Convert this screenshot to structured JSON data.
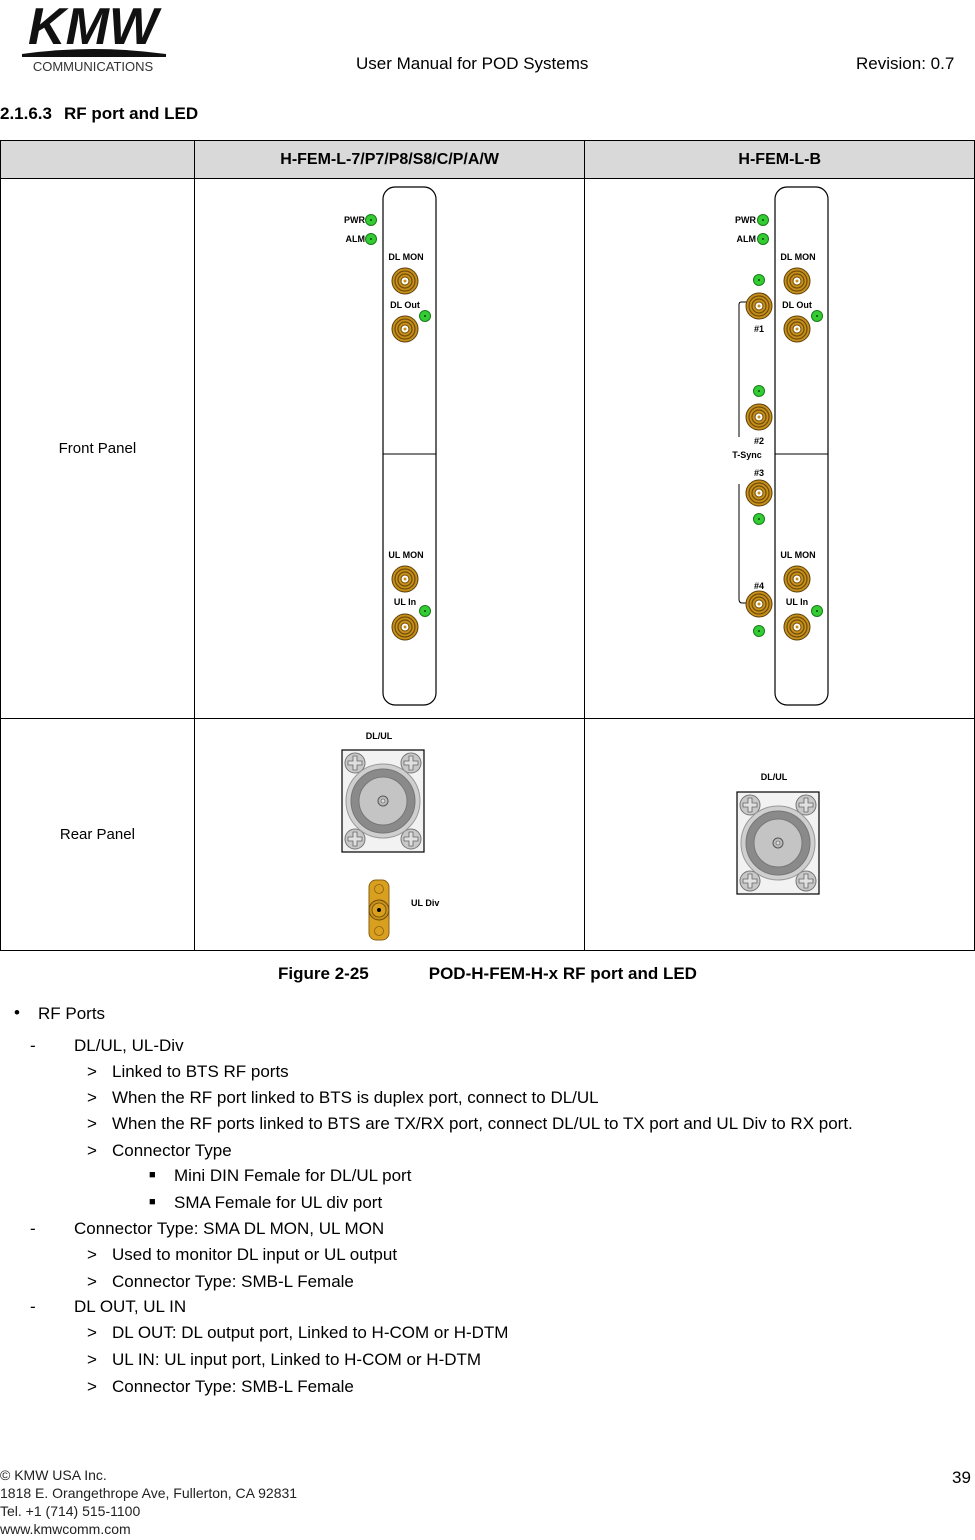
{
  "header": {
    "logo": {
      "name": "KMW",
      "subtitle": "COMMUNICATIONS"
    },
    "title": "User Manual for POD Systems",
    "revision": "Revision: 0.7"
  },
  "section": {
    "number": "2.1.6.3",
    "title": "RF port and LED"
  },
  "table": {
    "columns": [
      "",
      "H-FEM-L-7/P7/P8/S8/C/P/A/W",
      "H-FEM-L-B"
    ],
    "rows": [
      {
        "label": "Front Panel"
      },
      {
        "label": "Rear Panel"
      }
    ],
    "front_panel": {
      "led_pwr": "PWR",
      "led_alm": "ALM",
      "dl_mon": "DL MON",
      "dl_out": "DL Out",
      "ul_mon": "UL MON",
      "ul_in": "UL In",
      "tsync": "T-Sync",
      "tsync_ports": [
        "#1",
        "#2",
        "#3",
        "#4"
      ],
      "led_color": "#33cc33",
      "connector_color": "#c8901a"
    },
    "rear_panel": {
      "dl_ul": "DL/UL",
      "ul_div": "UL Div"
    }
  },
  "caption": {
    "figure": "Figure 2-25",
    "text": "POD-H-FEM-H-x RF port and LED"
  },
  "body": {
    "bullet": "RF Ports",
    "items": [
      {
        "level": 1,
        "marker": "-",
        "text": "DL/UL, UL-Div"
      },
      {
        "level": 2,
        "marker": ">",
        "text": "Linked  to BTS RF ports"
      },
      {
        "level": 2,
        "marker": ">",
        "text": "When the RF port linked to BTS is duplex port, connect to DL/UL"
      },
      {
        "level": 2,
        "marker": ">",
        "text": "When the RF ports linked to BTS are TX/RX port, connect DL/UL to TX port and UL Div to RX port."
      },
      {
        "level": 2,
        "marker": ">",
        "text": "Connector Type"
      },
      {
        "level": 3,
        "marker": "■",
        "text": "Mini DIN Female for DL/UL port"
      },
      {
        "level": 3,
        "marker": "■",
        "text": "SMA Female for UL div port"
      },
      {
        "level": 1,
        "marker": "-",
        "text": "Connector Type: SMA DL MON, UL MON"
      },
      {
        "level": 2,
        "marker": ">",
        "text": "Used to monitor DL input or UL output"
      },
      {
        "level": 2,
        "marker": ">",
        "text": "Connector Type: SMB-L Female"
      },
      {
        "level": 1,
        "marker": "-",
        "text": "DL OUT, UL IN"
      },
      {
        "level": 2,
        "marker": ">",
        "text": "DL OUT: DL output port, Linked to H-COM or H-DTM"
      },
      {
        "level": 2,
        "marker": ">",
        "text": "UL IN: UL input port, Linked to H-COM or H-DTM"
      },
      {
        "level": 2,
        "marker": ">",
        "text": "Connector Type: SMB-L Female"
      }
    ]
  },
  "footer": {
    "copyright": "© KMW USA Inc.",
    "address": "1818 E. Orangethrope Ave, Fullerton, CA 92831",
    "tel": "Tel. +1 (714) 515-1100",
    "web": "www.kmwcomm.com",
    "page": "39"
  }
}
